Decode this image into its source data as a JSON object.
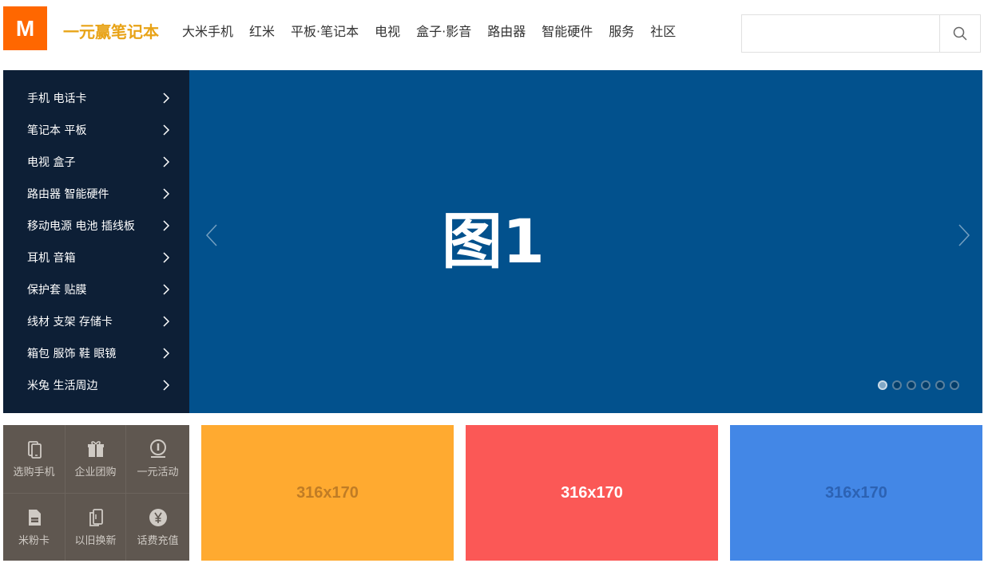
{
  "header": {
    "logo_text": "M",
    "brand": "一元赢笔记本",
    "nav": [
      "大米手机",
      "红米",
      "平板·笔记本",
      "电视",
      "盒子·影音",
      "路由器",
      "智能硬件",
      "服务",
      "社区"
    ],
    "search": {
      "value": "",
      "placeholder": ""
    }
  },
  "sidebar": {
    "items": [
      {
        "label": "手机 电话卡"
      },
      {
        "label": "笔记本 平板"
      },
      {
        "label": "电视 盒子"
      },
      {
        "label": "路由器 智能硬件"
      },
      {
        "label": "移动电源 电池 插线板"
      },
      {
        "label": "耳机 音箱"
      },
      {
        "label": "保护套 贴膜"
      },
      {
        "label": "线材 支架 存储卡"
      },
      {
        "label": "箱包 服饰 鞋 眼镜"
      },
      {
        "label": "米兔 生活周边"
      }
    ]
  },
  "banner": {
    "text": "图1",
    "background": "#02518d",
    "dot_count": 6,
    "active_dot": 1
  },
  "quick_links": [
    {
      "label": "选购手机",
      "icon": "phone-icon"
    },
    {
      "label": "企业团购",
      "icon": "gift-icon"
    },
    {
      "label": "一元活动",
      "icon": "coin-icon"
    },
    {
      "label": "米粉卡",
      "icon": "sim-card-icon"
    },
    {
      "label": "以旧换新",
      "icon": "trade-in-icon"
    },
    {
      "label": "话费充值",
      "icon": "yen-icon"
    }
  ],
  "promos": [
    {
      "label": "316x170",
      "bg": "#ffaa30",
      "fg": "#c07c25"
    },
    {
      "label": "316x170",
      "bg": "#fb5856",
      "fg": "#ffffff"
    },
    {
      "label": "316x170",
      "bg": "#4387e6",
      "fg": "#2c62b3"
    }
  ],
  "colors": {
    "accent": "#ff6700",
    "brand_text": "#e8a317",
    "sidebar_bg": "#0d1f36",
    "quick_bg": "#5f5750"
  }
}
